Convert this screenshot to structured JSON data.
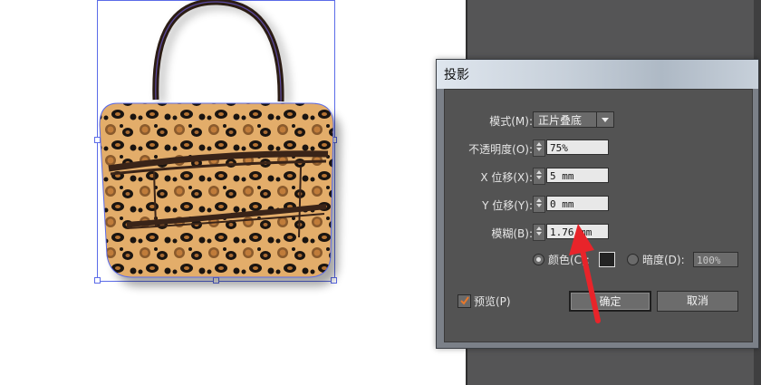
{
  "dialog": {
    "title": "投影",
    "mode": {
      "label": "模式(M):",
      "value": "正片叠底"
    },
    "opacity": {
      "label": "不透明度(O):",
      "value": "75%"
    },
    "x_offset": {
      "label": "X 位移(X):",
      "value": "5 mm"
    },
    "y_offset": {
      "label": "Y 位移(Y):",
      "value": "0 mm"
    },
    "blur": {
      "label": "模糊(B):",
      "value": "1.76 mm"
    },
    "color_option": {
      "label": "颜色(C):",
      "selected": true,
      "swatch": "#232323"
    },
    "darkness_option": {
      "label": "暗度(D):",
      "value": "100%",
      "selected": false
    },
    "preview": {
      "label": "预览(P)",
      "checked": true
    },
    "ok_label": "确定",
    "cancel_label": "取消"
  },
  "canvas": {
    "artwork": "leopard-print-handbag-icon",
    "annotation": "red-arrow-icon",
    "colors": {
      "fur": "#e3ad6a",
      "spot": "#1a1410",
      "strap": "#3a2418",
      "arrow": "#e8242a",
      "selection": "#5b6be8"
    }
  }
}
